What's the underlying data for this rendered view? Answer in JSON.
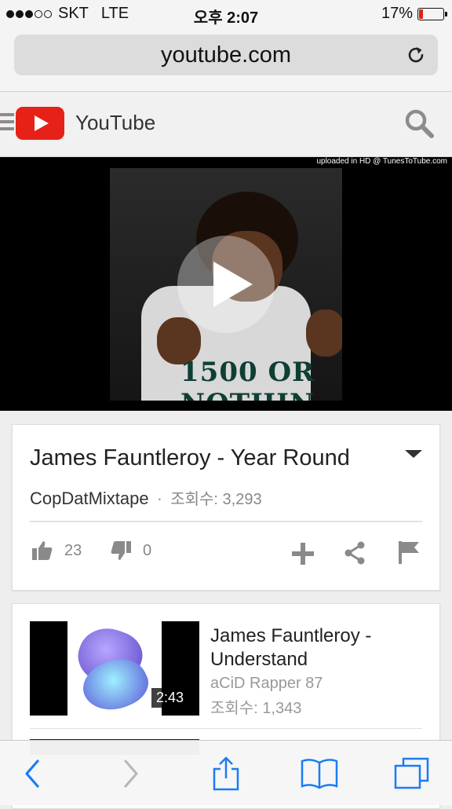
{
  "status_bar": {
    "carrier": "SKT",
    "network": "LTE",
    "time": "오후 2:07",
    "battery_text": "17%",
    "battery_level": 0.17,
    "signal_bars": 3,
    "signal_total": 5
  },
  "browser": {
    "url": "youtube.com",
    "reload_icon": "reload-icon"
  },
  "header": {
    "title": "YouTube",
    "brand_color": "#e62117",
    "menu_icon": "menu-icon",
    "search_icon": "search-icon"
  },
  "video": {
    "upload_note": "uploaded in HD @ TunesToTube.com",
    "shirt_text": "1500 OR NOTHIN",
    "play_icon": "play-icon"
  },
  "info": {
    "title": "James Fauntleroy - Year Round",
    "channel": "CopDatMixtape",
    "separator": "·",
    "views": "조회수: 3,293",
    "likes": "23",
    "dislikes": "0"
  },
  "related": [
    {
      "title": "James Fauntleroy - Understand",
      "channel": "aCiD Rapper 87",
      "views": "조회수: 1,343",
      "duration": "2:43"
    }
  ],
  "toolbar": {
    "icons": [
      "back-icon",
      "forward-icon",
      "share-icon",
      "bookmarks-icon",
      "tabs-icon"
    ]
  }
}
